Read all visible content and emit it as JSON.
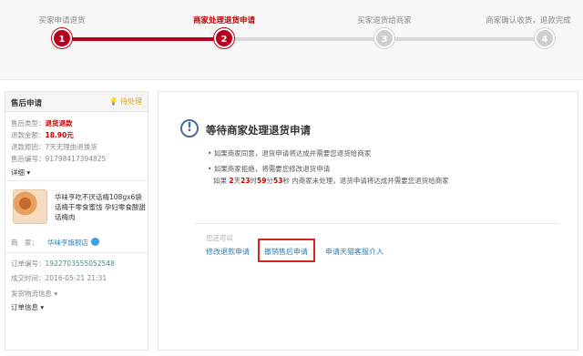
{
  "steps": [
    {
      "label": "买家申请退货",
      "num": "1"
    },
    {
      "label": "商家处理退货申请",
      "num": "2"
    },
    {
      "label": "买家退货给商家",
      "num": "3"
    },
    {
      "label": "商家确认收货，退款完成",
      "num": "4"
    }
  ],
  "colors": {
    "accent": "#b4001e",
    "link": "#2a7fb8",
    "highlight_box": "#d9231e"
  },
  "sidebar": {
    "title": "售后申请",
    "status": "待处理",
    "type_label": "售后类型：",
    "type_value": "退货退款",
    "amount_label": "退款金额：",
    "amount_value": "18.90元",
    "reason_label": "退款原因：",
    "reason_value": "7天无理由退换货",
    "no_label": "售后编号：",
    "no_value": "91798417394825",
    "details": "详细",
    "product_name": "华味亨吃不厌话梅108gx6袋话梅干零食蜜饯 孕妇零食酸甜话梅肉",
    "store_label": "商　家：",
    "store_name": "华味亨旗舰店",
    "order_no_label": "订单编号：",
    "order_no_value": "1922703555052548",
    "deal_time_label": "成交时间：",
    "deal_time_value": "2016-05-21 21:31",
    "shipping_label": "发货物流信息",
    "order_info_label": "订单信息"
  },
  "main": {
    "title": "等待商家处理退货申请",
    "bullet1": "如果商家同意，退货申请将达成并需要您退货给商家",
    "bullet2": "如果商家拒绝，将需要您修改退货申请",
    "countdown_prefix": "如果 ",
    "days": "2",
    "days_unit": "天",
    "hours": "23",
    "hours_unit": "时",
    "minutes": "59",
    "minutes_unit": "分",
    "seconds": "53",
    "seconds_unit": "秒",
    "countdown_suffix": " 内商家未处理，退货申请将达成并需要您退货给商家",
    "can_do": "您还可以",
    "actions": [
      "修改退款申请",
      "撤销售后申请",
      "申请天猫客服介入"
    ]
  }
}
